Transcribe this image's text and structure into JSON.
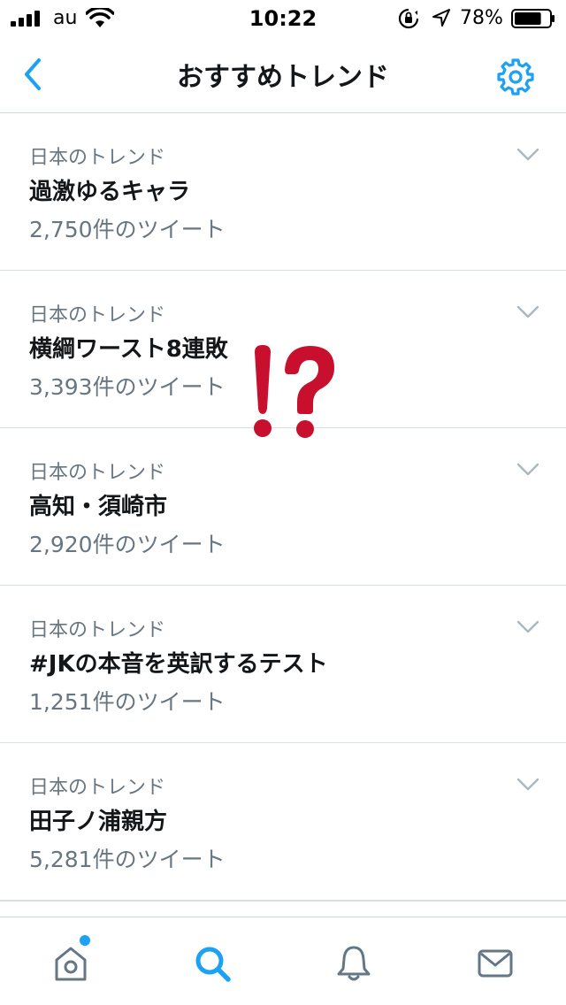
{
  "status_bar": {
    "carrier": "au",
    "time": "10:22",
    "battery": "78%",
    "battery_level": 0.78
  },
  "nav": {
    "title": "おすすめトレンド"
  },
  "trends": [
    {
      "context": "日本のトレンド",
      "name": "過激ゆるキャラ",
      "count": "2,750件のツイート"
    },
    {
      "context": "日本のトレンド",
      "name": "横綱ワースト8連敗",
      "count": "3,393件のツイート"
    },
    {
      "context": "日本のトレンド",
      "name": "高知・須崎市",
      "count": "2,920件のツイート"
    },
    {
      "context": "日本のトレンド",
      "name": "#JKの本音を英訳するテスト",
      "count": "1,251件のツイート"
    },
    {
      "context": "日本のトレンド",
      "name": "田子ノ浦親方",
      "count": "5,281件のツイート"
    }
  ],
  "tabs": [
    {
      "icon": "home-icon",
      "has_notification_dot": true
    },
    {
      "icon": "search-icon",
      "active": true
    },
    {
      "icon": "bell-icon"
    },
    {
      "icon": "mail-icon"
    }
  ],
  "colors": {
    "accent": "#1da1f2",
    "secondary_text": "#687682",
    "primary_text": "#14171a",
    "divider": "#d8dee3",
    "overlay_mark": "#c8102e"
  }
}
